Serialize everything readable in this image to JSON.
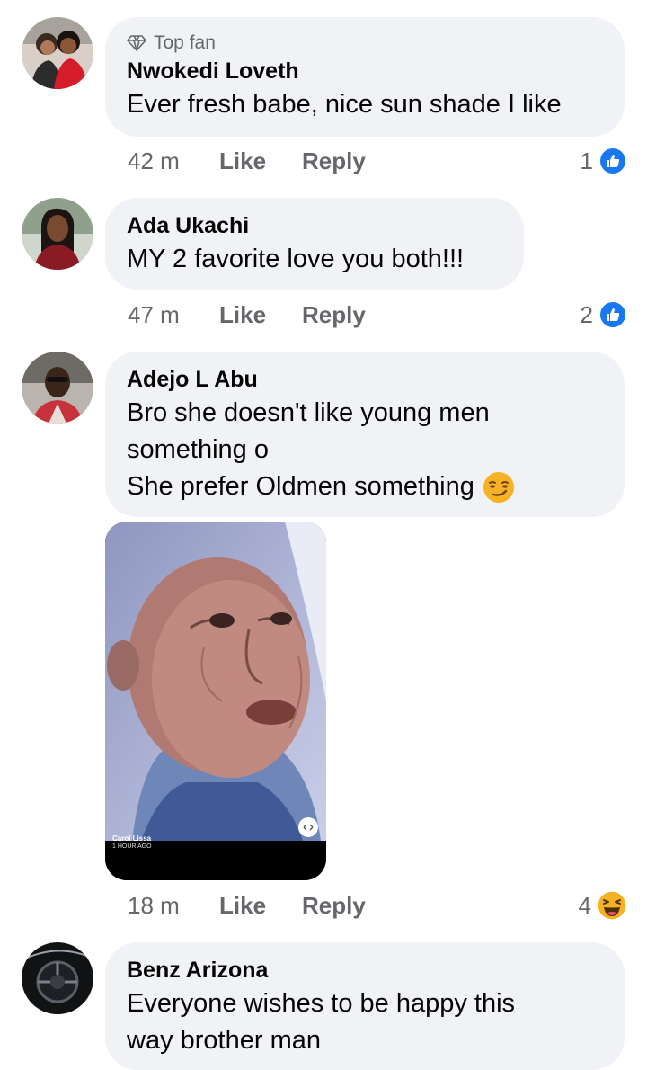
{
  "comments": [
    {
      "badge": "Top fan",
      "author": "Nwokedi Loveth",
      "text": "Ever fresh babe, nice sun shade I like",
      "time": "42 m",
      "like": "Like",
      "reply": "Reply",
      "reaction_count": "1",
      "reaction_icon": "like-icon"
    },
    {
      "author": "Ada Ukachi",
      "text": "MY 2 favorite love you both!!!",
      "time": "47 m",
      "like": "Like",
      "reply": "Reply",
      "reaction_count": "2",
      "reaction_icon": "like-icon"
    },
    {
      "author": "Adejo L Abu",
      "text_lines": [
        "Bro she doesn't like young men",
        "something o",
        "She prefer Oldmen something"
      ],
      "emoji": "smirk-emoji",
      "time": "18 m",
      "like": "Like",
      "reply": "Reply",
      "reaction_count": "4",
      "reaction_icon": "haha-icon",
      "photo": {
        "caption_name": "Carol Lissa",
        "caption_time": "1 HOUR AGO"
      }
    },
    {
      "author": "Benz Arizona",
      "text_lines": [
        "Everyone wishes to be happy this",
        "way brother man"
      ]
    }
  ],
  "colors": {
    "bubble": "#f0f2f5",
    "meta": "#65676b",
    "text": "#050505",
    "like_blue": "#1877f2",
    "haha_yellow": "#f7b125"
  }
}
